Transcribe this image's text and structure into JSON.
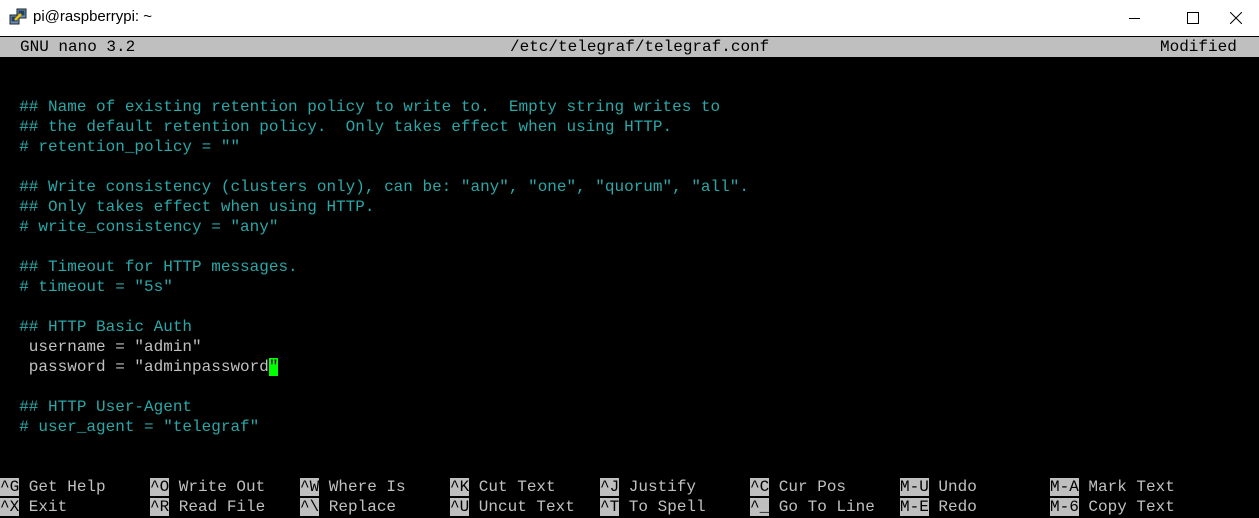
{
  "window": {
    "title": "pi@raspberrypi: ~",
    "icon": "putty-terminal-icon",
    "controls": [
      "minimize",
      "maximize",
      "close"
    ]
  },
  "nano": {
    "version": "GNU nano 3.2",
    "filename": "/etc/telegraf/telegraf.conf",
    "status": "Modified"
  },
  "colors": {
    "comment": "#2aa7a7",
    "text": "#c0c0c0",
    "background": "#000000",
    "header_bg": "#bfbfbf",
    "cursor": "#00ff00"
  },
  "lines": [
    {
      "text": "  ## Name of existing retention policy to write to.  Empty string writes to",
      "type": "comment"
    },
    {
      "text": "  ## the default retention policy.  Only takes effect when using HTTP.",
      "type": "comment"
    },
    {
      "text": "  # retention_policy = \"\"",
      "type": "comment"
    },
    {
      "text": "",
      "type": "blank"
    },
    {
      "text": "  ## Write consistency (clusters only), can be: \"any\", \"one\", \"quorum\", \"all\".",
      "type": "comment"
    },
    {
      "text": "  ## Only takes effect when using HTTP.",
      "type": "comment"
    },
    {
      "text": "  # write_consistency = \"any\"",
      "type": "comment"
    },
    {
      "text": "",
      "type": "blank"
    },
    {
      "text": "  ## Timeout for HTTP messages.",
      "type": "comment"
    },
    {
      "text": "  # timeout = \"5s\"",
      "type": "comment"
    },
    {
      "text": "",
      "type": "blank"
    },
    {
      "text": "  ## HTTP Basic Auth",
      "type": "comment"
    },
    {
      "text": "   username = \"admin\"",
      "type": "code"
    },
    {
      "text": "   password = \"adminpassword",
      "type": "code",
      "cursor_char": "\""
    },
    {
      "text": "",
      "type": "blank"
    },
    {
      "text": "  ## HTTP User-Agent",
      "type": "comment"
    },
    {
      "text": "  # user_agent = \"telegraf\"",
      "type": "comment"
    }
  ],
  "shortcuts": [
    {
      "key": "^G",
      "label": "Get Help"
    },
    {
      "key": "^X",
      "label": "Exit"
    },
    {
      "key": "^O",
      "label": "Write Out"
    },
    {
      "key": "^R",
      "label": "Read File"
    },
    {
      "key": "^W",
      "label": "Where Is"
    },
    {
      "key": "^\\",
      "label": "Replace"
    },
    {
      "key": "^K",
      "label": "Cut Text"
    },
    {
      "key": "^U",
      "label": "Uncut Text"
    },
    {
      "key": "^J",
      "label": "Justify"
    },
    {
      "key": "^T",
      "label": "To Spell"
    },
    {
      "key": "^C",
      "label": "Cur Pos"
    },
    {
      "key": "^_",
      "label": "Go To Line"
    },
    {
      "key": "M-U",
      "label": "Undo"
    },
    {
      "key": "M-E",
      "label": "Redo"
    },
    {
      "key": "M-A",
      "label": "Mark Text"
    },
    {
      "key": "M-6",
      "label": "Copy Text"
    }
  ]
}
